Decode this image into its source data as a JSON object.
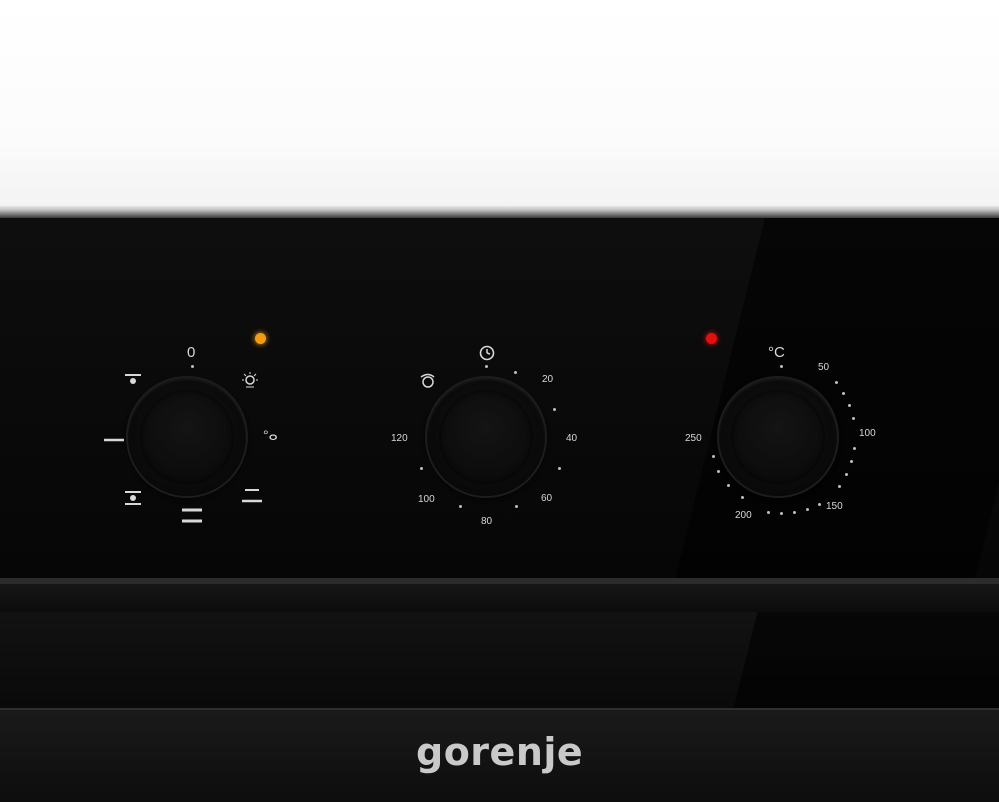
{
  "brand": {
    "name": "gorenje"
  },
  "colors": {
    "panel": "#0a0a0a",
    "lamp_function": "#f39c12",
    "lamp_temperature": "#e01010",
    "label": "#d8d8d8"
  },
  "function_knob": {
    "top_label": "0",
    "icons": [
      "fan-icon",
      "light-bulb-icon",
      "defrost-icon",
      "grill-icon",
      "bottom-heat-icon",
      "top-bottom-heat-icon",
      "top-heat-icon"
    ]
  },
  "timer_knob": {
    "icons": [
      "clock-icon",
      "manual-icon"
    ],
    "labels": [
      "20",
      "40",
      "60",
      "80",
      "100",
      "120"
    ]
  },
  "temperature_knob": {
    "unit": "°C",
    "labels": [
      "50",
      "100",
      "150",
      "200",
      "250"
    ]
  }
}
